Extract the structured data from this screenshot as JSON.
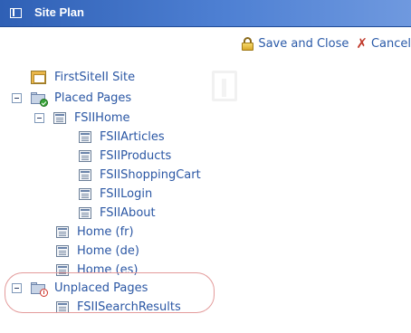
{
  "window": {
    "title": "Site Plan"
  },
  "actions": {
    "save_close": "Save and Close",
    "cancel": "Cancel"
  },
  "tree": {
    "site": "FirstSiteII Site",
    "placed": {
      "label": "Placed Pages",
      "home": {
        "label": "FSIIHome",
        "children": [
          "FSIIArticles",
          "FSIIProducts",
          "FSIIShoppingCart",
          "FSIILogin",
          "FSIIAbout"
        ]
      },
      "others": [
        "Home (fr)",
        "Home (de)",
        "Home (es)"
      ]
    },
    "unplaced": {
      "label": "Unplaced Pages",
      "children": [
        "FSIISearchResults"
      ]
    }
  },
  "colors": {
    "titlebar": "#3d6fc4",
    "link": "#2b57a4",
    "highlight": "#e39a9a"
  }
}
